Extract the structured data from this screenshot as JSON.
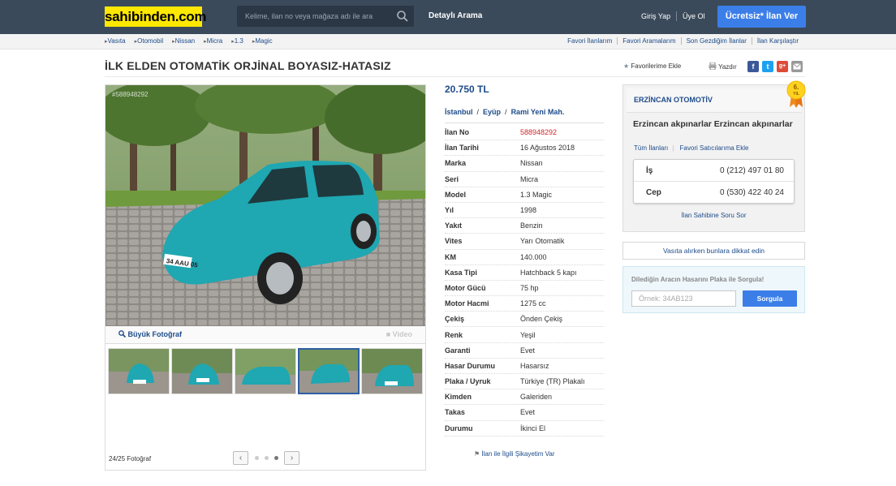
{
  "header": {
    "logo": "sahibinden.com",
    "search_placeholder": "Kelime, ilan no veya mağaza adı ile ara",
    "detailed_search": "Detaylı Arama",
    "login": "Giriş Yap",
    "signup": "Üye Ol",
    "post_ad": "Ücretsiz* İlan Ver"
  },
  "breadcrumb": [
    "Vasıta",
    "Otomobil",
    "Nissan",
    "Micra",
    "1.3",
    "Magic"
  ],
  "top_links": [
    "Favori İlanlarım",
    "Favori Aramalarım",
    "Son Gezdiğim İlanlar",
    "İlan Karşılaştır"
  ],
  "listing": {
    "title": "İLK ELDEN OTOMATİK ORJİNAL BOYASIZ-HATASIZ",
    "add_favorite": "Favorilerime Ekle",
    "print": "Yazdır",
    "price": "20.750 TL",
    "location": [
      "İstanbul",
      "Eyüp",
      "Rami Yeni Mah."
    ],
    "location_sep": "/",
    "details": [
      {
        "key": "İlan No",
        "value": "588948292"
      },
      {
        "key": "İlan Tarihi",
        "value": "16 Ağustos 2018"
      },
      {
        "key": "Marka",
        "value": "Nissan"
      },
      {
        "key": "Seri",
        "value": "Micra"
      },
      {
        "key": "Model",
        "value": "1.3 Magic"
      },
      {
        "key": "Yıl",
        "value": "1998"
      },
      {
        "key": "Yakıt",
        "value": "Benzin"
      },
      {
        "key": "Vites",
        "value": "Yarı Otomatik"
      },
      {
        "key": "KM",
        "value": "140.000"
      },
      {
        "key": "Kasa Tipi",
        "value": "Hatchback 5 kapı"
      },
      {
        "key": "Motor Gücü",
        "value": "75 hp"
      },
      {
        "key": "Motor Hacmi",
        "value": "1275 cc"
      },
      {
        "key": "Çekiş",
        "value": "Önden Çekiş"
      },
      {
        "key": "Renk",
        "value": "Yeşil"
      },
      {
        "key": "Garanti",
        "value": "Evet"
      },
      {
        "key": "Hasar Durumu",
        "value": "Hasarsız"
      },
      {
        "key": "Plaka / Uyruk",
        "value": "Türkiye (TR) Plakalı"
      },
      {
        "key": "Kimden",
        "value": "Galeriden"
      },
      {
        "key": "Takas",
        "value": "Evet"
      },
      {
        "key": "Durumu",
        "value": "İkinci El"
      }
    ],
    "complaint": "İlan ile İlgili Şikayetim Var"
  },
  "gallery": {
    "photo_id": "#588948292",
    "big_photo": "Büyük Fotoğraf",
    "video": "Video",
    "count": "24/25 Fotoğraf",
    "prev": "‹",
    "next": "›",
    "thumb_count": 5,
    "active_thumb": 3,
    "plate_text": "34 AAU 05",
    "car_color": "#1fa7b2"
  },
  "seller": {
    "name": "ERZİNCAN OTOMOTİV",
    "badge_year": "6.",
    "badge_label": "YIL",
    "description": "Erzincan akpınarlar Erzincan akpınarlar",
    "all_listings": "Tüm İlanları",
    "add_favorite_seller": "Favori Satıcılarıma Ekle",
    "phone_work_label": "İş",
    "phone_work": "0 (212) 497 01 80",
    "phone_mobile_label": "Cep",
    "phone_mobile": "0 (530) 422 40 24",
    "ask": "İlan Sahibine Soru Sor"
  },
  "notice": "Vasıta alırken bunlara dikkat edin",
  "plate_query": {
    "title": "Dilediğin Aracın Hasarını Plaka ile Sorgula!",
    "placeholder": "Örnek: 34AB123",
    "button": "Sorgula"
  },
  "colors": {
    "header_bg": "#3b4a5a",
    "logo_bg": "#ffe800",
    "accent_blue": "#3b7ee8",
    "link_blue": "#1d4b8a",
    "ad_no_red": "#d0252a"
  }
}
